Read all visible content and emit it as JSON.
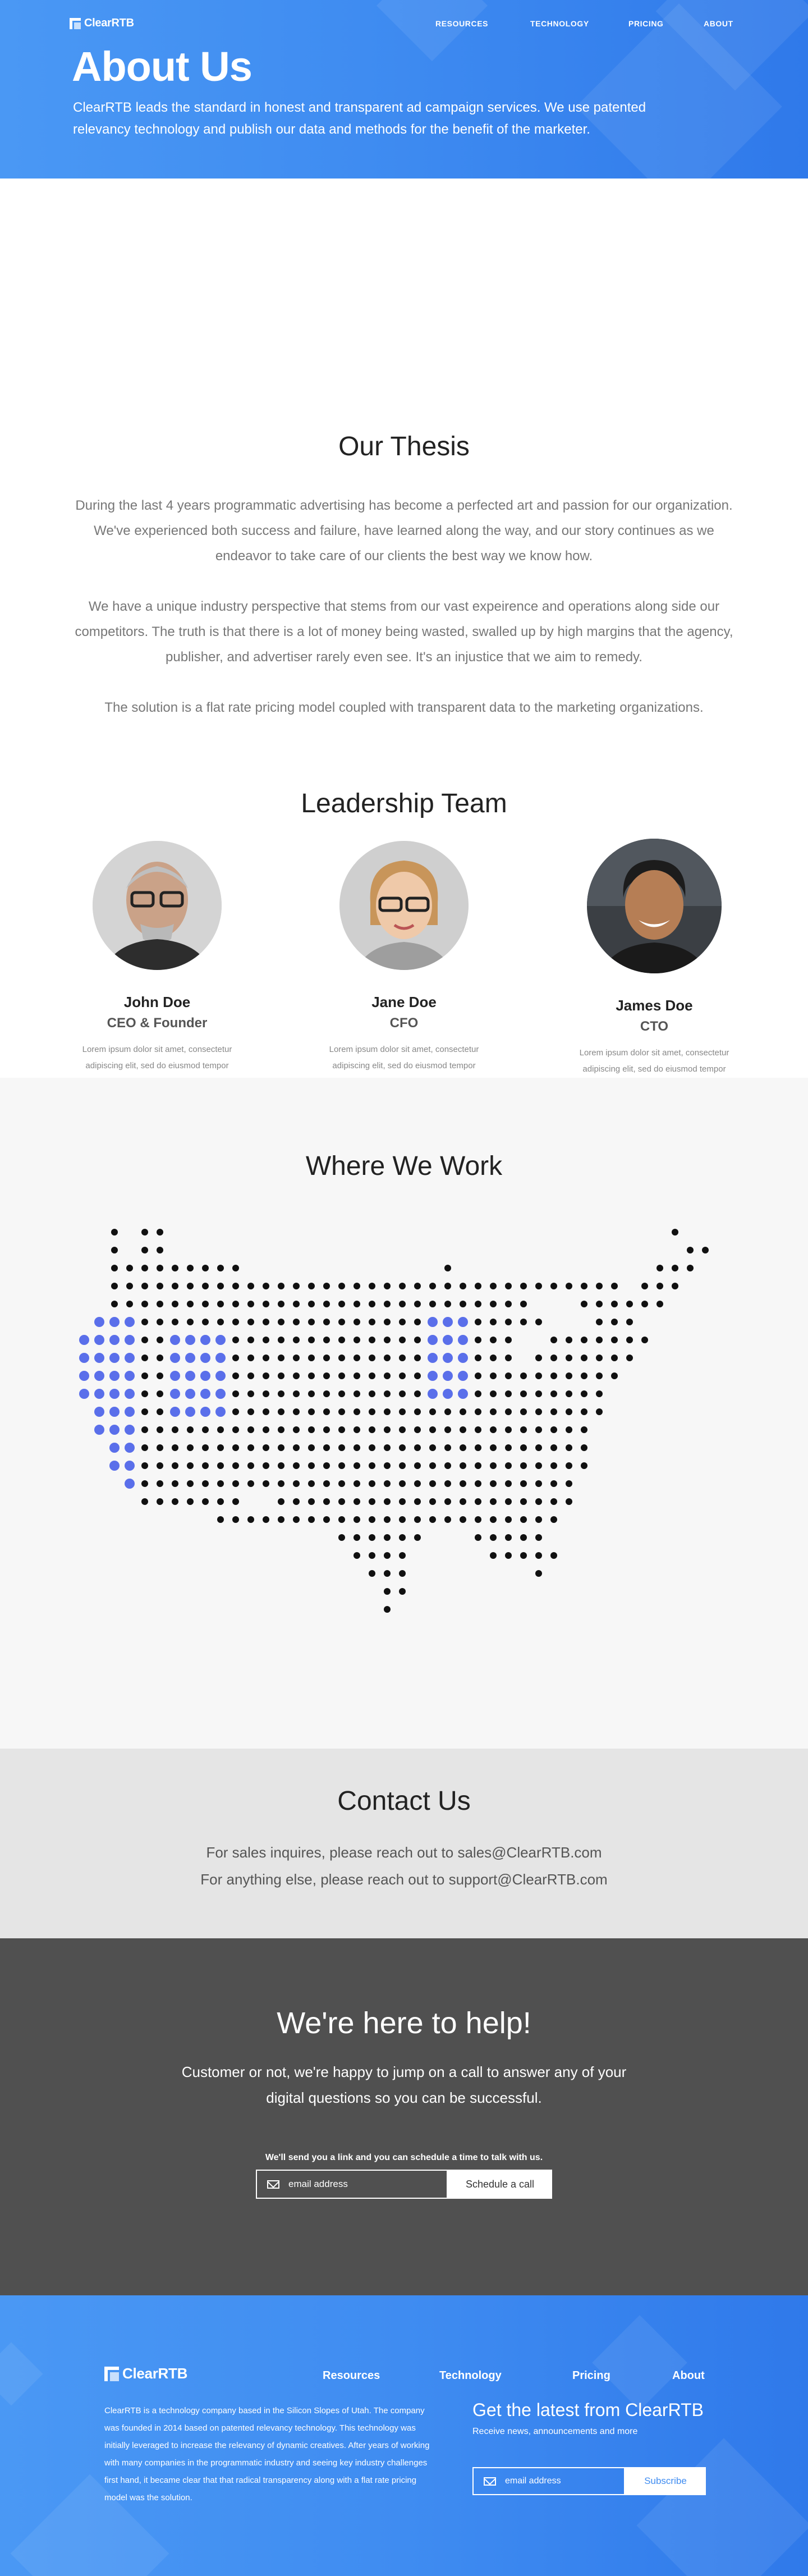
{
  "nav": {
    "brand": "ClearRTB",
    "brand_tm": "™",
    "links": [
      "RESOURCES",
      "TECHNOLOGY",
      "PRICING",
      "ABOUT"
    ]
  },
  "hero": {
    "title": "About Us",
    "subtitle": "ClearRTB leads the standard in honest and transparent ad campaign services. We use patented relevancy technology and publish our data and methods for the benefit of the marketer."
  },
  "thesis": {
    "title": "Our Thesis",
    "paragraphs": [
      "During the last 4 years programmatic advertising has become a perfected art and passion for our organization. We've experienced both success and failure, have learned along the way, and our story continues as we endeavor to take care of our clients the best way we know how.",
      "We have a unique industry perspective that stems from our vast expeirence and operations along side our competitors. The truth is that there is a lot of money being wasted, swalled up by high margins that the agency, publisher, and advertiser rarely even see. It's an injustice that we aim to remedy.",
      "The solution is a flat rate pricing model coupled with transparent data to the marketing organizations."
    ]
  },
  "leadership": {
    "title": "Leadership Team",
    "people": [
      {
        "name": "John Doe",
        "role": "CEO & Founder",
        "bio": "Lorem ipsum dolor sit amet, consectetur adipiscing elit, sed do eiusmod tempor incididunt ut labore et dolore magna aliqua. Ut enim ad minim veniam, quis nostrud exercitation ullamco laboris nisi ut aliquip ex ea commodo consequat."
      },
      {
        "name": "Jane Doe",
        "role": "CFO",
        "bio": "Lorem ipsum dolor sit amet, consectetur adipiscing elit, sed do eiusmod tempor incididunt ut labore et dolore magna aliqua. Ut enim ad minim veniam, quis nostrud exercitation ullamco laboris nisi ut aliquip ex ea commodo consequat."
      },
      {
        "name": "James Doe",
        "role": "CTO",
        "bio": "Lorem ipsum dolor sit amet, consectetur adipiscing elit, sed do eiusmod tempor incididunt ut labore et dolore magna aliqua. Ut enim ad minim veniam, quis nostrud exercitation ullamco laboris nisi ut aliquip ex ea commodo consequat."
      }
    ]
  },
  "work": {
    "title": "Where We Work",
    "dot_color": "#111111",
    "highlight_color": "#5a6fea"
  },
  "contact": {
    "title": "Contact Us",
    "line1": "For sales inquires, please reach out to sales@ClearRTB.com",
    "line2": "For anything else, please reach out to support@ClearRTB.com"
  },
  "help": {
    "title": "We're here to help!",
    "lead": "Customer or not, we're happy to jump on a call to answer any of your digital questions so you can be successful.",
    "note": "We'll send you a link and you can schedule a time to talk with us.",
    "email_placeholder": "email address",
    "button": "Schedule a call"
  },
  "footer": {
    "brand": "ClearRTB",
    "brand_tm": "™",
    "links": [
      "Resources",
      "Technology",
      "Pricing",
      "About"
    ],
    "about": "ClearRTB is a technology company based in the Silicon Slopes of Utah.  The company was founded in 2014 based on patented relevancy technology.  This technology was initially leveraged to increase the relevancy of dynamic creatives.  After years of working with many companies in the programmatic industry and seeing key industry challenges first hand, it became clear that that radical transparency along with a flat rate pricing model was the solution.",
    "newsletter_title": "Get the latest from ClearRTB",
    "newsletter_sub": "Receive news, announcements and more",
    "email_placeholder": "email address",
    "button": "Subscribe"
  },
  "colors": {
    "brand_blue": "#3f8cf1",
    "dark_band": "#505050",
    "contact_band": "#e5e5e5"
  }
}
